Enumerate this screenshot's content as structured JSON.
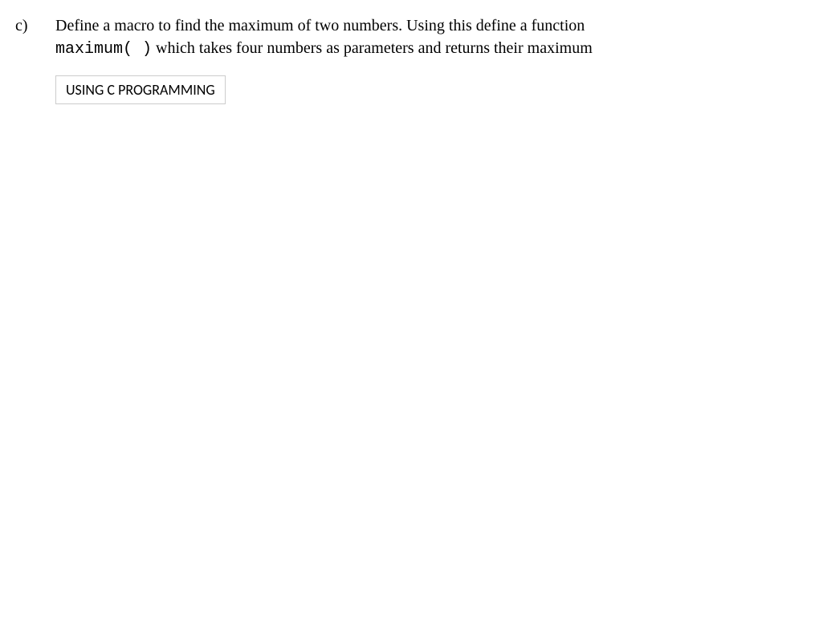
{
  "question": {
    "label": "c)",
    "text_line1": "Define a macro to find the maximum of two numbers. Using this define a function",
    "function_name": "maximum( )",
    "text_line2_rest": " which takes four numbers as parameters and returns their maximum",
    "note": "USING C PROGRAMMING"
  }
}
